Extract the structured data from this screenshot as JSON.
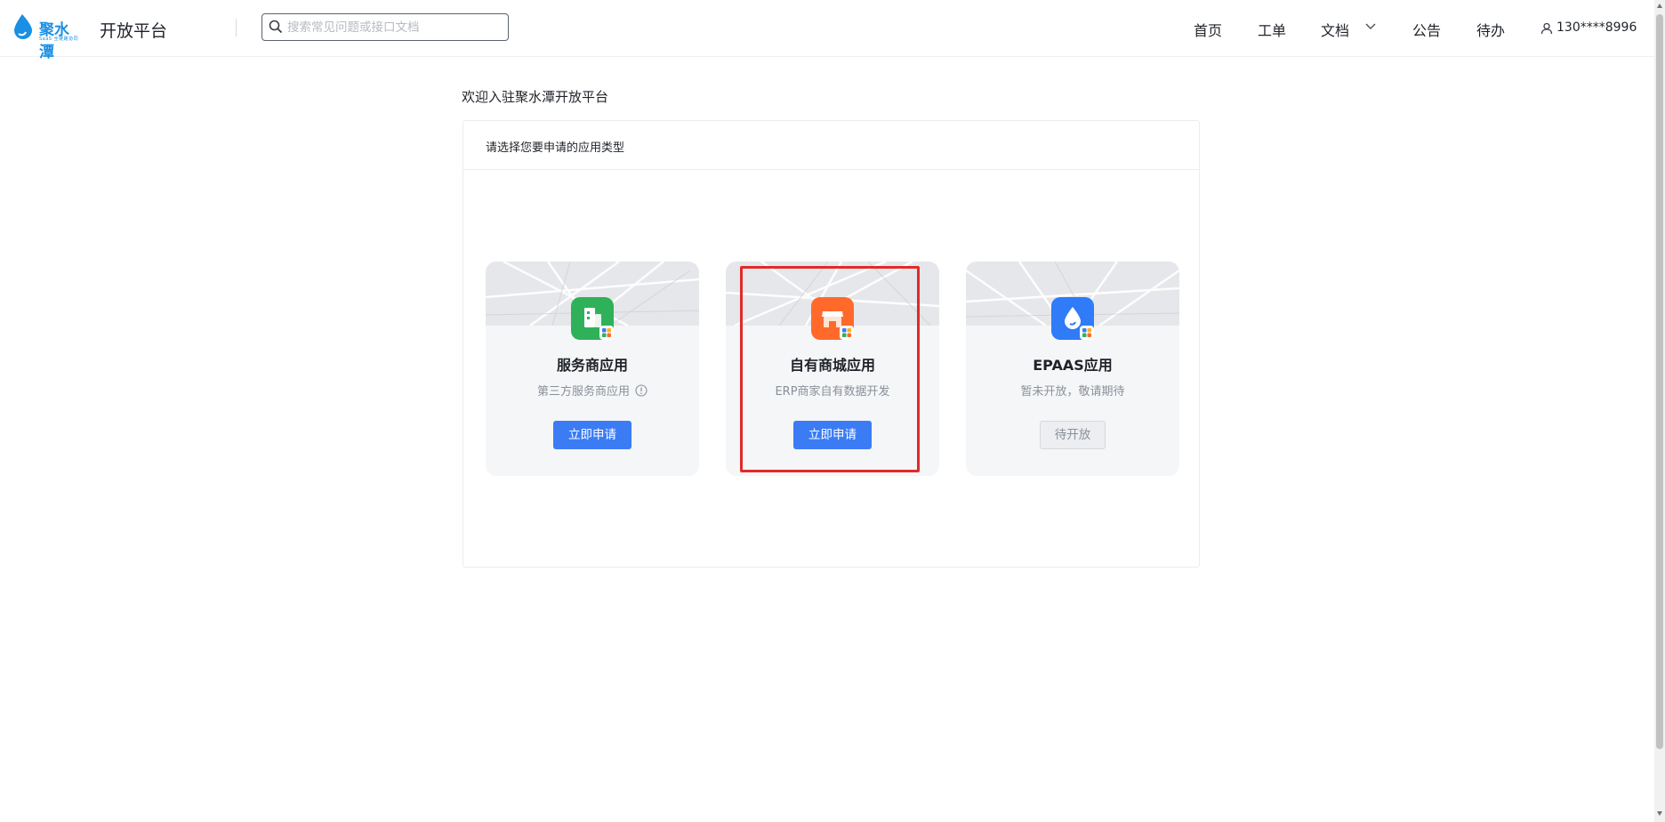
{
  "header": {
    "logo_text": "聚水潭",
    "logo_subtext": "SaaS 全链路协同",
    "platform_title": "开放平台",
    "search_placeholder": "搜索常见问题或接口文档",
    "nav": [
      "首页",
      "工单",
      "文档",
      "公告",
      "待办"
    ],
    "user": "130****8996"
  },
  "main": {
    "welcome": "欢迎入驻聚水潭开放平台",
    "panel_title": "请选择您要申请的应用类型",
    "cards": [
      {
        "title": "服务商应用",
        "desc": "第三方服务商应用",
        "button": "立即申请",
        "icon": "building-icon",
        "color": "#2fb15a"
      },
      {
        "title": "自有商城应用",
        "desc": "ERP商家自有数据开发",
        "button": "立即申请",
        "icon": "store-icon",
        "color": "#ff6a2b"
      },
      {
        "title": "EPAAS应用",
        "desc": "暂未开放，敬请期待",
        "button": "待开放",
        "icon": "water-drop-icon",
        "color": "#2f7bf8"
      }
    ]
  },
  "colors": {
    "primary": "#3b7cf5",
    "brand": "#1a8fe3",
    "highlight": "#e22a2a"
  }
}
